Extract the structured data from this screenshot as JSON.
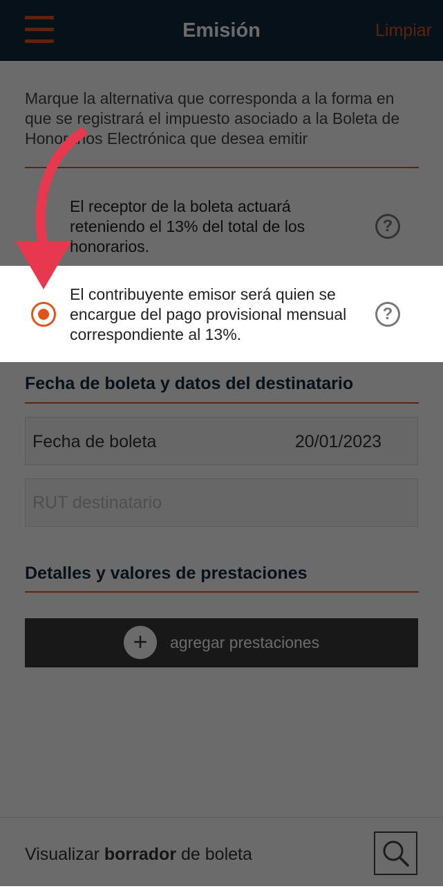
{
  "app_bar": {
    "title": "Emisión",
    "menu_icon": "hamburger-menu-icon",
    "clear_label": "Limpiar",
    "background": "#0f2a3f",
    "accent": "#e0531b"
  },
  "intro": {
    "text": "Marque la alternativa que corresponda a la forma en que se registrará el impuesto asociado a la Boleta de Honorarios Electrónica que desea emitir"
  },
  "options": [
    {
      "text": "El receptor de la boleta actuará reteniendo el 13% del total de los honorarios.",
      "selected": false,
      "help": "?"
    },
    {
      "text": "El contribuyente emisor será quien se encargue del pago provisional mensual correspondiente al 13%.",
      "selected": true,
      "help": "?"
    }
  ],
  "section_recipient": {
    "title": "Fecha de boleta y datos del destinatario",
    "date_label": "Fecha de boleta",
    "date_value": "20/01/2023",
    "rut_placeholder": "RUT destinatario"
  },
  "section_services": {
    "title": "Detalles y valores de prestaciones",
    "add_label": "agregar prestaciones",
    "add_icon": "plus-icon"
  },
  "bottom_bar": {
    "prefix": "Visualizar ",
    "bold": "borrador",
    "suffix": " de boleta",
    "search_icon": "search-icon"
  },
  "annotation": {
    "arrow_color": "#e8384f"
  }
}
